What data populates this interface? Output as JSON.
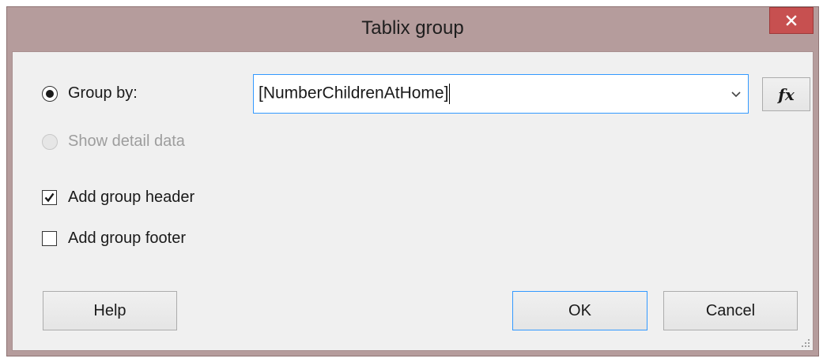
{
  "dialog": {
    "title": "Tablix group",
    "close_icon": "close-icon"
  },
  "options": {
    "group_by_label": "Group by:",
    "group_by_selected": true,
    "show_detail_label": "Show detail data",
    "show_detail_enabled": false,
    "add_header_label": "Add group header",
    "add_header_checked": true,
    "add_footer_label": "Add group footer",
    "add_footer_checked": false
  },
  "group_expression": {
    "value": "[NumberChildrenAtHome]",
    "dropdown_icon": "chevron-down-icon",
    "fx_label": "fx"
  },
  "buttons": {
    "help": "Help",
    "ok": "OK",
    "cancel": "Cancel"
  },
  "colors": {
    "title_bar": "#b59c9c",
    "close_button": "#c75050",
    "focus_border": "#3399ff",
    "client_bg": "#f0f0f0"
  }
}
